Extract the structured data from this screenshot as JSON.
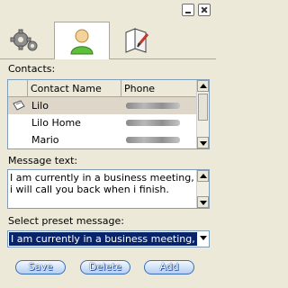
{
  "window": {
    "minimize_icon": "minimize-icon",
    "close_icon": "close-icon"
  },
  "tabs": [
    {
      "icon": "gears-icon",
      "selected": false
    },
    {
      "icon": "user-icon",
      "selected": true
    },
    {
      "icon": "notebook-icon",
      "selected": false
    }
  ],
  "contacts": {
    "label": "Contacts:",
    "columns": [
      "",
      "Contact Name",
      "Phone"
    ],
    "rows": [
      {
        "name": "Lilo",
        "selected": true,
        "icon": "contact-card-icon"
      },
      {
        "name": "Lilo Home",
        "selected": false
      },
      {
        "name": "Mario",
        "selected": false
      }
    ]
  },
  "message": {
    "label": "Message text:",
    "text": "I am currently in a business meeting, i will call you back when i finish."
  },
  "preset": {
    "label": "Select preset message:",
    "selected": "I am currently in a business meeting, i will call you back when i finish."
  },
  "buttons": {
    "save": "Save",
    "delete": "Delete",
    "add": "Add"
  },
  "colors": {
    "selection": "#0a246a",
    "row_selected": "#ded7c9",
    "button_border": "#3b6fb6"
  }
}
